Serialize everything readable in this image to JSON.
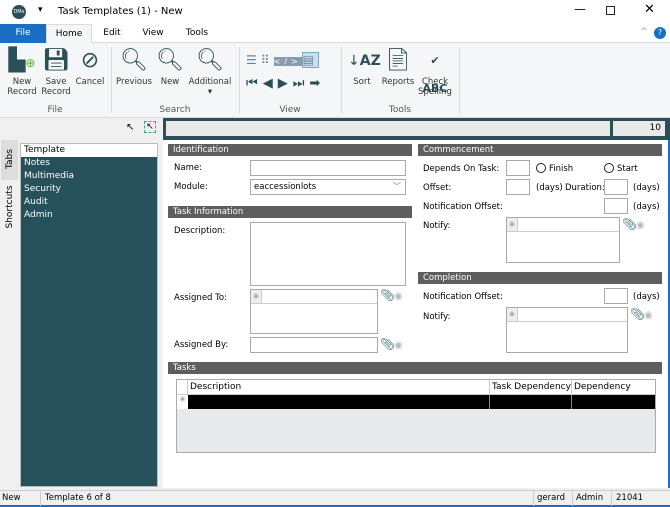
{
  "window": {
    "title": "Task Templates (1) - New",
    "app_icon": "DMx",
    "quick_access": "▾"
  },
  "menu": {
    "tabs": [
      "File",
      "Home",
      "Edit",
      "View",
      "Tools"
    ],
    "active": "Home",
    "file_color": "#1a6fc4"
  },
  "ribbon": {
    "file": {
      "label": "File",
      "buttons": [
        {
          "label": "New\nRecord",
          "icon": "new-record-icon"
        },
        {
          "label": "Save\nRecord",
          "icon": "save-icon"
        },
        {
          "label": "Cancel",
          "icon": "cancel-icon"
        }
      ]
    },
    "search": {
      "label": "Search",
      "buttons": [
        {
          "label": "Previous",
          "icon": "search-previous-icon"
        },
        {
          "label": "New",
          "icon": "search-new-icon"
        },
        {
          "label": "Additional",
          "icon": "search-additional-icon"
        }
      ]
    },
    "view": {
      "label": "View"
    },
    "tools": {
      "label": "Tools",
      "buttons": [
        {
          "label": "Sort",
          "icon": "sort-az-icon"
        },
        {
          "label": "Reports",
          "icon": "reports-icon"
        },
        {
          "label": "Check\nSpelling",
          "icon": "spellcheck-icon"
        }
      ]
    }
  },
  "sidebar": {
    "vtabs": [
      "Tabs",
      "Shortcuts"
    ],
    "header": "Template",
    "items": [
      "Notes",
      "Multimedia",
      "Security",
      "Audit",
      "Admin"
    ],
    "color": "#26505a"
  },
  "topbar": {
    "count": "10"
  },
  "identification": {
    "title": "Identification",
    "name_label": "Name:",
    "name_value": "",
    "module_label": "Module:",
    "module_value": "eaccessionlots"
  },
  "task_info": {
    "title": "Task Information",
    "description_label": "Description:",
    "assigned_to_label": "Assigned To:",
    "assigned_by_label": "Assigned By:"
  },
  "commencement": {
    "title": "Commencement",
    "depends_label": "Depends On Task:",
    "finish_label": "Finish",
    "start_label": "Start",
    "offset_label": "Offset:",
    "days": "(days)",
    "duration_label": "Duration:",
    "notif_offset_label": "Notification Offset:",
    "notify_label": "Notify:"
  },
  "completion": {
    "title": "Completion",
    "notif_offset_label": "Notification Offset:",
    "days": "(days)",
    "notify_label": "Notify:"
  },
  "tasks": {
    "title": "Tasks",
    "columns": [
      "Description",
      "Task Dependency",
      "Dependency Offset"
    ]
  },
  "status": {
    "mode": "New",
    "record": "Template 6 of 8",
    "user": "gerard",
    "role": "Admin",
    "id": "21041"
  }
}
